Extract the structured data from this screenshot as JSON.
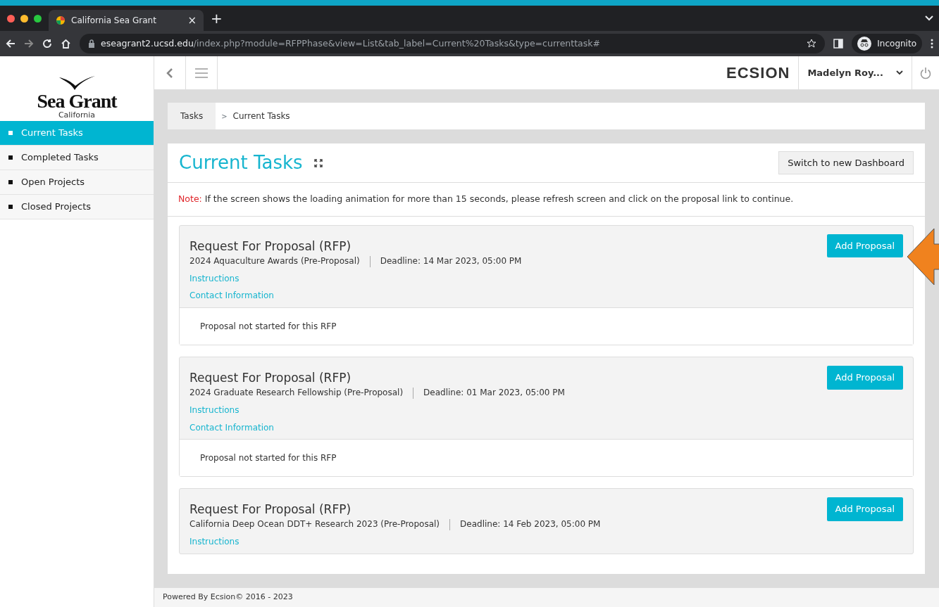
{
  "browser": {
    "tab_title": "California Sea Grant",
    "tab_close": "×",
    "new_tab": "+",
    "url_host": "eseagrant2.ucsd.edu",
    "url_path": "/index.php?module=RFPPhase&view=List&tab_label=Current%20Tasks&type=currenttask#",
    "profile": "Incognito"
  },
  "sidebar": {
    "logo_title": "Sea Grant",
    "logo_subtitle": "California",
    "items": [
      {
        "label": "Current Tasks",
        "selected": true
      },
      {
        "label": "Completed Tasks",
        "selected": false
      },
      {
        "label": "Open Projects",
        "selected": false
      },
      {
        "label": "Closed Projects",
        "selected": false
      }
    ]
  },
  "header": {
    "brand": "ECSION",
    "user": "Madelyn Roy..."
  },
  "breadcrumb": [
    "Tasks",
    "Current Tasks"
  ],
  "breadcrumb_separator": ">",
  "page": {
    "title": "Current Tasks",
    "action": "Switch to new Dashboard",
    "note_label": "Note:",
    "note": "If the screen shows the loading animation for more than 15 seconds, please refresh screen and click on the proposal link to continue."
  },
  "cards": [
    {
      "title": "Request For Proposal (RFP)",
      "program": "2024 Aquaculture Awards (Pre-Proposal)",
      "deadline": "Deadline:  14 Mar 2023, 05:00 PM",
      "button": "Add Proposal",
      "links": [
        "Instructions",
        "Contact Information"
      ],
      "status": "Proposal not started for this RFP"
    },
    {
      "title": "Request For Proposal (RFP)",
      "program": "2024 Graduate Research Fellowship (Pre-Proposal)",
      "deadline": "Deadline:  01 Mar 2023, 05:00 PM",
      "button": "Add Proposal",
      "links": [
        "Instructions",
        "Contact Information"
      ],
      "status": "Proposal not started for this RFP"
    },
    {
      "title": "Request For Proposal (RFP)",
      "program": "California Deep Ocean DDT+ Research 2023 (Pre-Proposal)",
      "deadline": "Deadline:  14 Feb 2023, 05:00 PM",
      "button": "Add Proposal",
      "links": [
        "Instructions"
      ]
    }
  ],
  "footer": "Powered By Ecsion© 2016 - 2023"
}
